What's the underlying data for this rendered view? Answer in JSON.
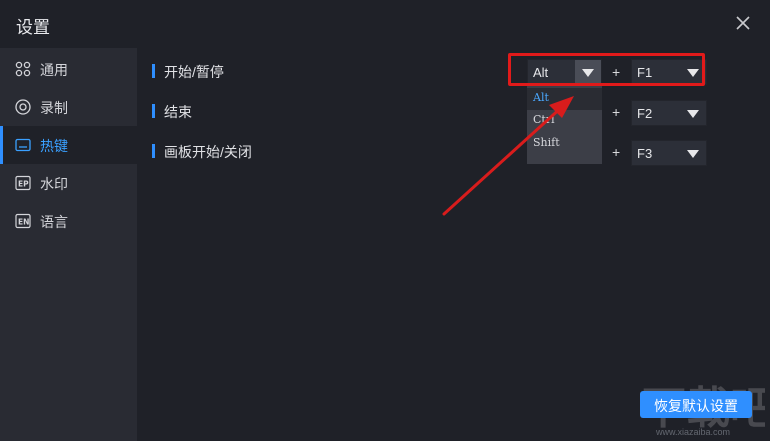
{
  "window": {
    "title": "设置",
    "close_icon": "close-icon"
  },
  "sidebar": {
    "items": [
      {
        "label": "通用",
        "icon": "grid-icon",
        "active": false
      },
      {
        "label": "录制",
        "icon": "record-icon",
        "active": false
      },
      {
        "label": "热键",
        "icon": "keyboard-icon",
        "active": true
      },
      {
        "label": "水印",
        "icon": "watermark-icon",
        "active": false
      },
      {
        "label": "语言",
        "icon": "language-icon",
        "active": false
      }
    ]
  },
  "hotkeys": [
    {
      "label": "开始/暂停",
      "modifier": "Alt",
      "key": "F1"
    },
    {
      "label": "结束",
      "modifier": "",
      "key": "F2"
    },
    {
      "label": "画板开始/关闭",
      "modifier": "",
      "key": "F3"
    }
  ],
  "plus_sign": "+",
  "modifier_dropdown": {
    "options": [
      "Alt",
      "Ctrl",
      "Shift"
    ],
    "selected": "Alt"
  },
  "footer": {
    "reset_label": "恢复默认设置"
  },
  "watermark": {
    "text": "下载吧",
    "url": "www.xiazaiba.com"
  },
  "colors": {
    "accent": "#2f8fff",
    "highlight": "#e11a1a",
    "background": "#1f2128",
    "sidebar": "#292b33"
  }
}
